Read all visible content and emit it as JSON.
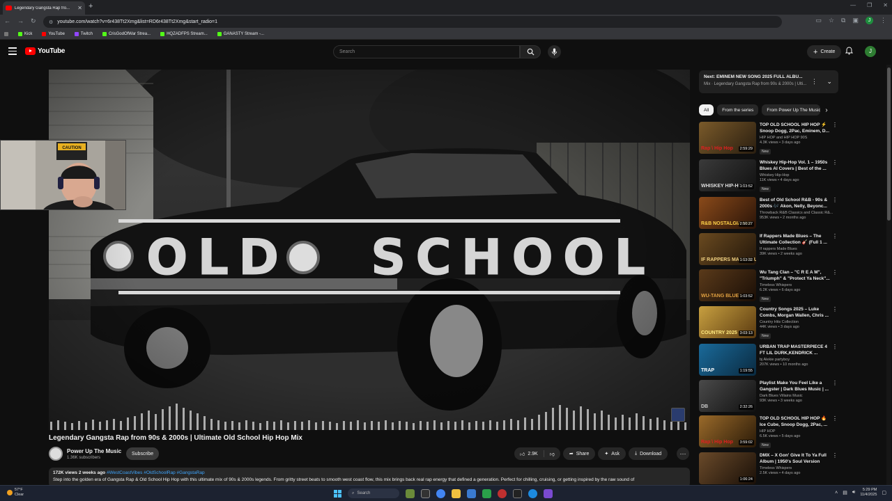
{
  "browser": {
    "tab_title": "Legendary Gangsta Rap fro...",
    "url": "youtube.com/watch?v=6r438Tt2Xmg&list=RD6r438Tt2Xmg&start_radio=1",
    "profile_initial": "J",
    "bookmarks": [
      {
        "label": "Kick",
        "color": "#53fc18"
      },
      {
        "label": "YouTube",
        "color": "#ff0000"
      },
      {
        "label": "Twitch",
        "color": "#9146ff"
      },
      {
        "label": "CrisGodOfWar Strea...",
        "color": "#53fc18"
      },
      {
        "label": "HQZADFPS Stream...",
        "color": "#53fc18"
      },
      {
        "label": "GANASTY Stream -...",
        "color": "#53fc18"
      }
    ]
  },
  "youtube": {
    "logo_text": "YouTube",
    "search_placeholder": "Search",
    "create_label": "Create",
    "avatar_initial": "J"
  },
  "video": {
    "overlay_word_1": "OLD",
    "overlay_word_2": "SCHOOL",
    "webcam_sign": "CAUTION",
    "title": "Legendary Gangsta Rap from 90s & 2000s | Ultimate Old School Hip Hop Mix",
    "channel": "Power Up The Music",
    "subscribers": "1.36K subscribers",
    "subscribe_label": "Subscribe",
    "likes": "2.9K",
    "share_label": "Share",
    "ask_label": "Ask",
    "download_label": "Download",
    "desc_meta": "172K views  2 weeks ago",
    "desc_tags": "#WestCoastVibes #OldSchoolRap #GangstaRap",
    "desc_body": "Step into the golden era of Gangsta Rap & Old School Hip Hop with this ultimate mix of 90s & 2000s legends. From gritty street beats to smooth west coast flow, this mix brings back real rap energy that defined a generation. Perfect for chilling, cruising, or getting inspired by the raw sound of"
  },
  "up_next": {
    "title": "Next: EMINEM NEW SONG 2025 FULL ALBU...",
    "subtitle": "Mix · Legendary Gangsta Rap from 90s & 2000s | Ulti..."
  },
  "chips": [
    "All",
    "From the series",
    "From Power Up The Music"
  ],
  "recommendations": [
    {
      "title": "TOP OLD SCHOOL HIP HOP ⚡ Snoop Dogg, 2Pac, Eminem, D...",
      "channel": "HIP HOP and HIP HOP 90S",
      "views": "4.3K views • 3 days ago",
      "badge": "New",
      "duration": "2:59:29",
      "thumb_text": "Rap \\ Hip Hop",
      "c1": "#7a5a2a",
      "c2": "#2a1e10",
      "accent": "#e02020"
    },
    {
      "title": "Whiskey Hip-Hop Vol. 1 – 1950s Blues AI Covers | Best of the ...",
      "channel": "Whiskey Hip-Hop",
      "views": "11K views • 4 days ago",
      "badge": "New",
      "duration": "1:13:52",
      "thumb_text": "WHISKEY HIP-HOP",
      "c1": "#3a3a3a",
      "c2": "#111",
      "accent": "#dddddd"
    },
    {
      "title": "Best of Old School R&B - 90s & 2000s 🎶 Akon, Nelly, Beyonc...",
      "channel": "Throwback R&B Classics and Classic R&...",
      "views": "953K views • 2 months ago",
      "badge": "",
      "duration": "2:50:27",
      "thumb_text": "R&B NOSTALGIA MIX",
      "c1": "#8a4a1a",
      "c2": "#2a1408",
      "accent": "#ffd24a"
    },
    {
      "title": "If Rappers Made Blues – The Ultimate Collection 🎸 (Full 1 ...",
      "channel": "If rappers Made Blues",
      "views": "39K views • 2 weeks ago",
      "badge": "",
      "duration": "1:13:32",
      "thumb_text": "IF RAPPERS MADE BLUES",
      "c1": "#6a4a20",
      "c2": "#22160a",
      "accent": "#f0d080"
    },
    {
      "title": "Wu Tang Clan – \"C R E A M\", \"Triumph\" & \"Protect Ya Neck\"...",
      "channel": "Timeless Whispers",
      "views": "6.2K views • 6 days ago",
      "badge": "New",
      "duration": "1:03:52",
      "thumb_text": "WU-TANG BLUES",
      "c1": "#5a3a1a",
      "c2": "#1a0e06",
      "accent": "#e0a040"
    },
    {
      "title": "Country Songs 2025 – Luke Combs, Morgan Wallen, Chris ...",
      "channel": "Country Hits Collection",
      "views": "44K views • 3 days ago",
      "badge": "New",
      "duration": "3:03:13",
      "thumb_text": "COUNTRY 2025",
      "c1": "#c8a040",
      "c2": "#5a3a10",
      "accent": "#ffea80"
    },
    {
      "title": "URBAN TRAP MASTERPIECE 4 FT LIL DURK,KENDRICK ...",
      "channel": "bj Alekie partyboy",
      "views": "207K views • 10 months ago",
      "badge": "",
      "duration": "1:19:55",
      "thumb_text": "TRAP",
      "c1": "#1a6a9a",
      "c2": "#0a2a40",
      "accent": "#ffffff"
    },
    {
      "title": "Playlist Make You Feel Like a Gangster | Dark Blues Music | ...",
      "channel": "Dark Blues Villains Music",
      "views": "93K views • 3 weeks ago",
      "badge": "",
      "duration": "2:32:26",
      "thumb_text": "DB",
      "c1": "#4a4a4a",
      "c2": "#101010",
      "accent": "#cccccc"
    },
    {
      "title": "TOP OLD SCHOOL HIP HOP 🔥 Ice Cube, Snoop Dogg, 2Pac, ...",
      "channel": "HIP HOP",
      "views": "6.5K views • 5 days ago",
      "badge": "New",
      "duration": "3:59:02",
      "thumb_text": "Rap \\ Hip Hop",
      "c1": "#9a6a2a",
      "c2": "#2a1a08",
      "accent": "#e02020"
    },
    {
      "title": "DMX – X Gon' Give It To Ya Full Album | 1950's Soul Version",
      "channel": "Timeless Whispers",
      "views": "2.5K views • 4 days ago",
      "badge": "",
      "duration": "1:06:24",
      "thumb_text": "",
      "c1": "#6a4a2a",
      "c2": "#1a1008",
      "accent": "#e0b060"
    }
  ],
  "taskbar": {
    "temp": "57°F",
    "weather": "Clear",
    "search_label": "Search",
    "time": "5:29 PM",
    "date": "11/4/2025"
  }
}
